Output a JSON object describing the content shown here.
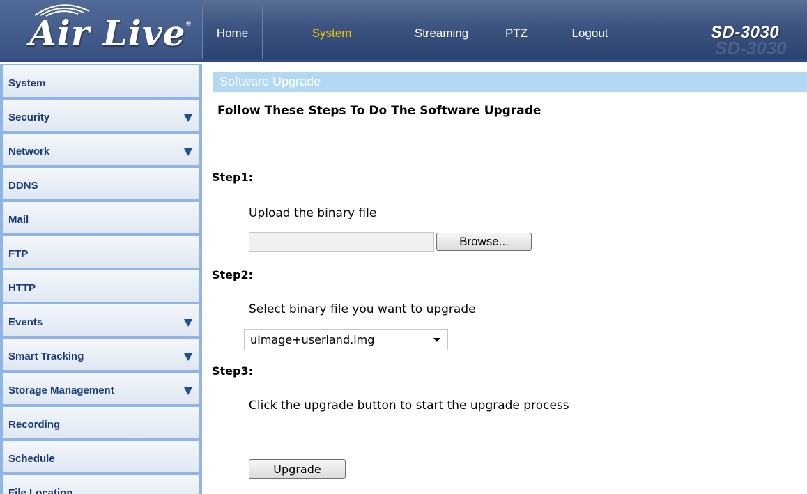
{
  "brand": {
    "logo_text": "Air Live",
    "logo_reg": "®",
    "model": "SD-3030"
  },
  "nav": {
    "items": [
      {
        "label": "Home"
      },
      {
        "label": "System",
        "active": true
      },
      {
        "label": "Streaming"
      },
      {
        "label": "PTZ"
      },
      {
        "label": "Logout"
      }
    ]
  },
  "sidebar": {
    "items": [
      {
        "label": "System",
        "has_submenu": false
      },
      {
        "label": "Security",
        "has_submenu": true
      },
      {
        "label": "Network",
        "has_submenu": true
      },
      {
        "label": "DDNS",
        "has_submenu": false
      },
      {
        "label": "Mail",
        "has_submenu": false
      },
      {
        "label": "FTP",
        "has_submenu": false
      },
      {
        "label": "HTTP",
        "has_submenu": false
      },
      {
        "label": "Events",
        "has_submenu": true
      },
      {
        "label": "Smart Tracking",
        "has_submenu": true
      },
      {
        "label": "Storage Management",
        "has_submenu": true
      },
      {
        "label": "Recording",
        "has_submenu": false
      },
      {
        "label": "Schedule",
        "has_submenu": false
      },
      {
        "label": "File Location",
        "has_submenu": false
      }
    ]
  },
  "main": {
    "section_title": "Software Upgrade",
    "heading": "Follow These Steps To Do The Software Upgrade",
    "step1": {
      "label": "Step1:",
      "instruction": "Upload the binary file",
      "file_value": "",
      "browse_label": "Browse..."
    },
    "step2": {
      "label": "Step2:",
      "instruction": "Select binary file you want to upgrade",
      "selected": "uImage+userland.img"
    },
    "step3": {
      "label": "Step3:",
      "instruction": "Click the upgrade button to start the upgrade process",
      "upgrade_label": "Upgrade"
    }
  },
  "colors": {
    "header_bg": "#3e5582",
    "nav_active": "#f2c200",
    "sidebar_bg": "#8fb4e6",
    "sidebar_text": "#173a7a",
    "section_bar": "#b3d8f4"
  }
}
